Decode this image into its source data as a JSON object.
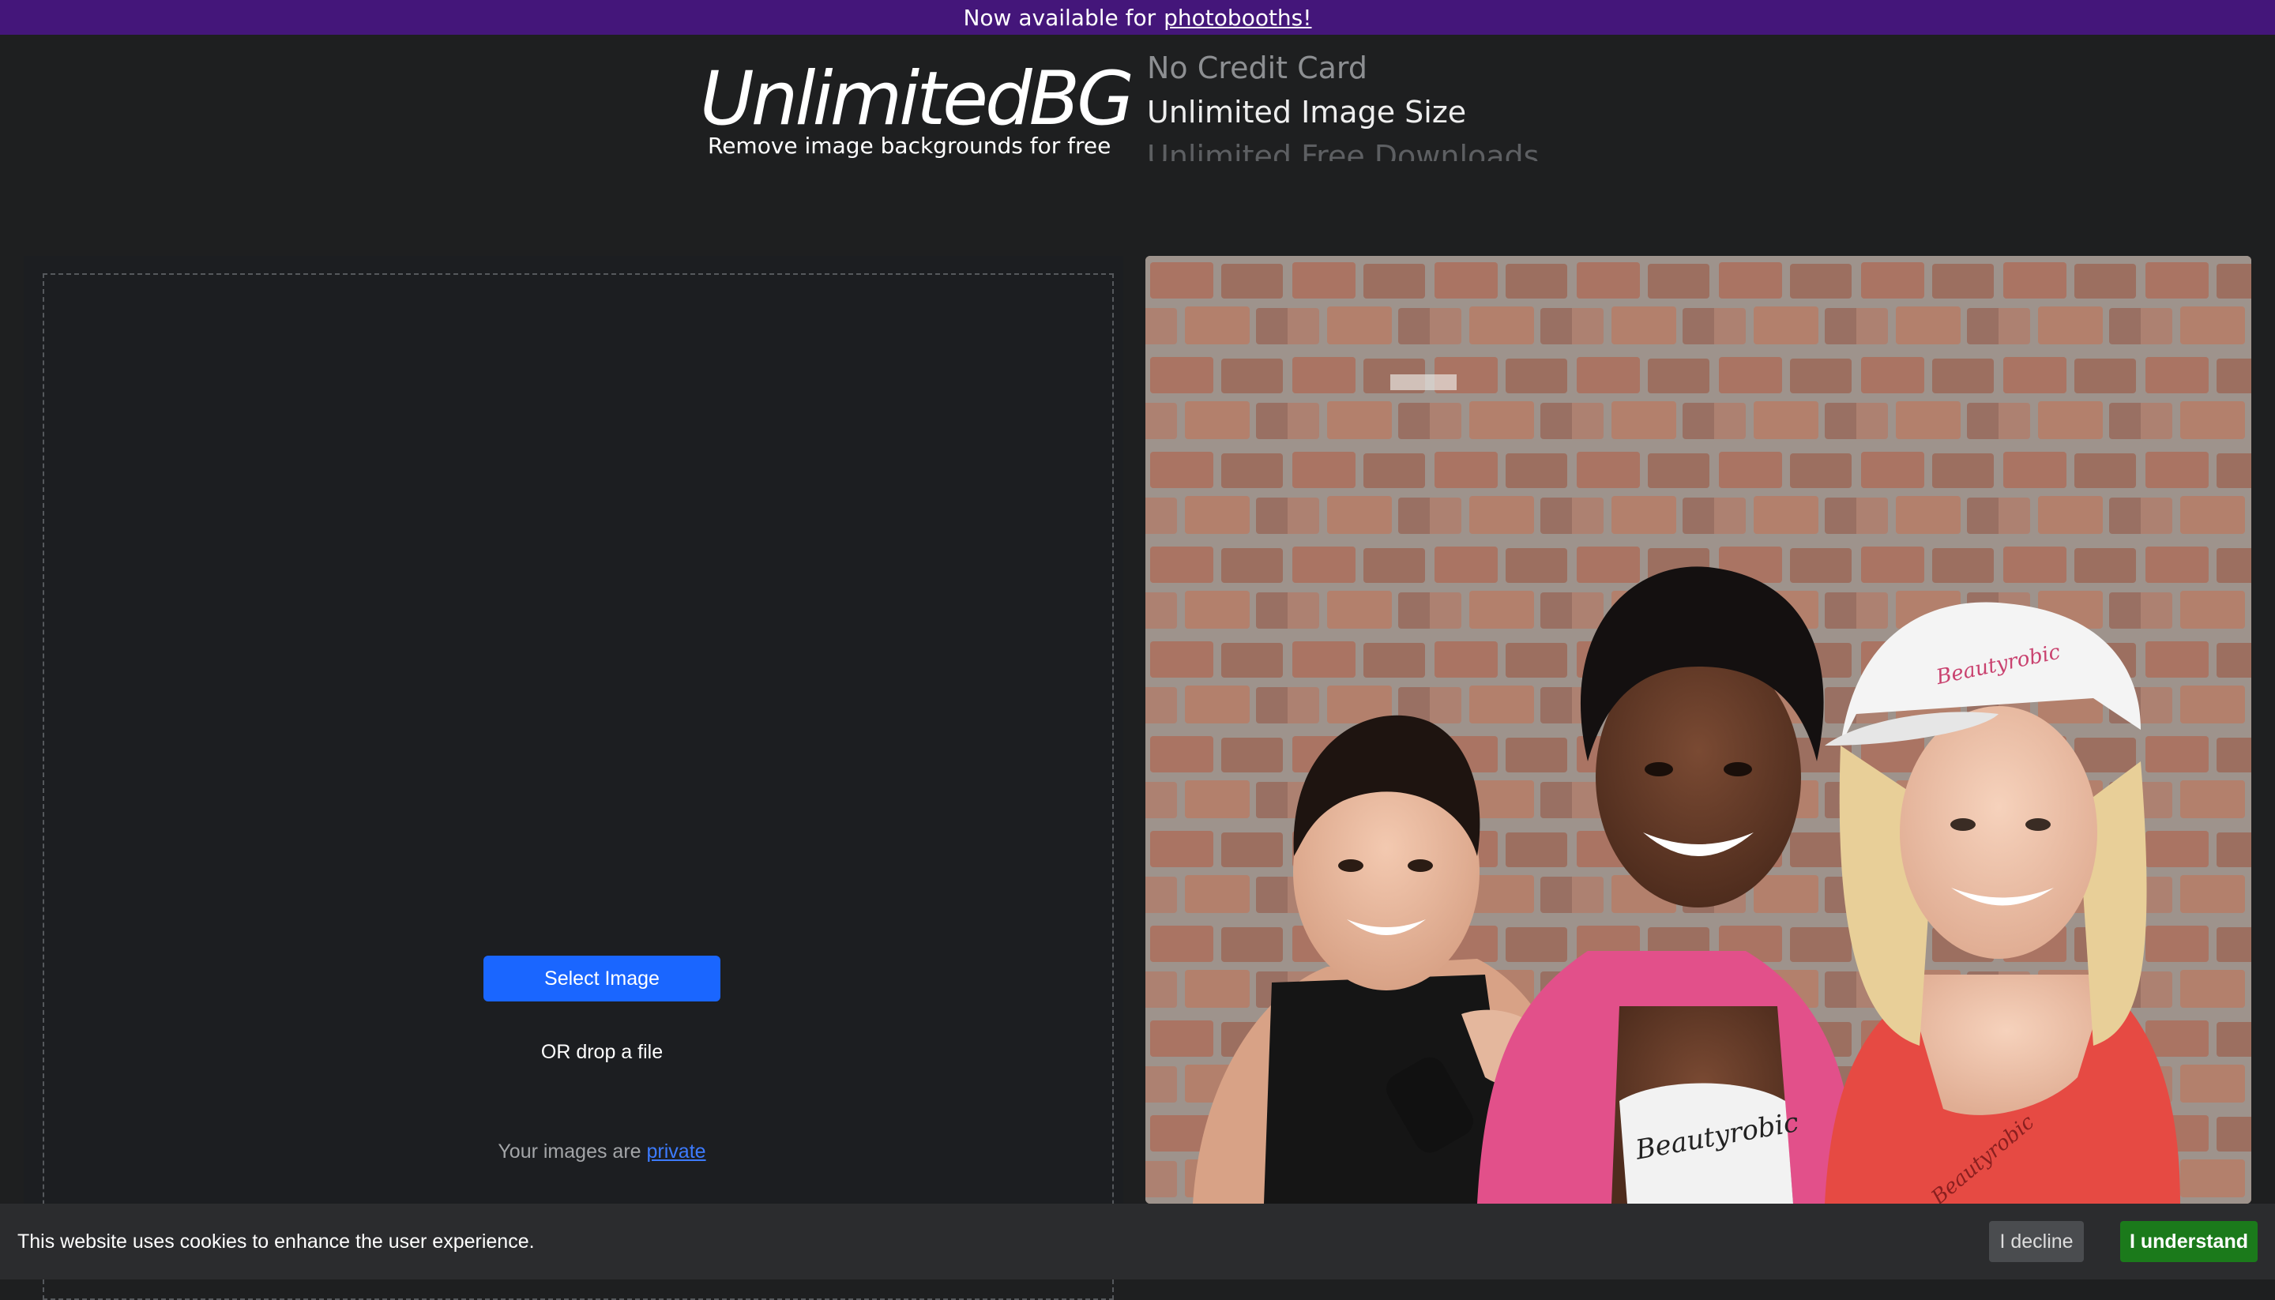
{
  "banner": {
    "prefix": "Now available for",
    "link_label": "photobooths!"
  },
  "header": {
    "logo": "UnlimitedBG",
    "tagline": "Remove image backgrounds for free",
    "features": [
      "No Credit Card",
      "Unlimited Image Size",
      "Unlimited Free Downloads"
    ]
  },
  "upload": {
    "select_label": "Select Image",
    "drop_label": "OR drop a file",
    "privacy_prefix": "Your images are",
    "privacy_link": "private"
  },
  "preview": {
    "shirt_brand": "Beautyrobic",
    "cap_brand": "Beautyrobic",
    "top_brand": "Beautyrobic"
  },
  "cookie": {
    "message": "This website uses cookies to enhance the user experience.",
    "decline_label": "I decline",
    "accept_label": "I understand"
  },
  "colors": {
    "banner": "#44167a",
    "primary_button": "#1a66ff",
    "accept_button": "#1b7a1b",
    "background": "#1e1f20"
  }
}
